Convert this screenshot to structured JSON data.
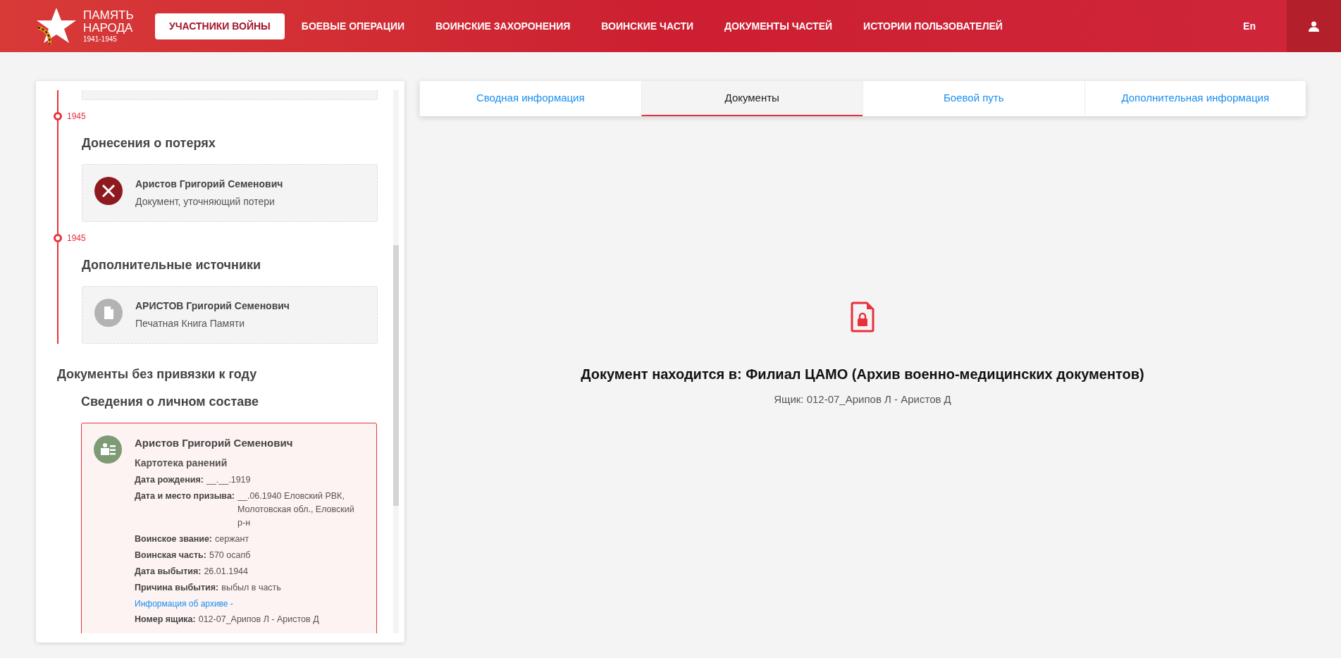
{
  "header": {
    "logo": {
      "line1": "ПАМЯТЬ",
      "line2": "НАРОДА",
      "years": "1941-1945"
    },
    "nav": [
      {
        "label": "УЧАСТНИКИ ВОЙНЫ",
        "selected": true
      },
      {
        "label": "БОЕВЫЕ ОПЕРАЦИИ",
        "selected": false
      },
      {
        "label": "ВОИНСКИЕ ЗАХОРОНЕНИЯ",
        "selected": false
      },
      {
        "label": "ВОИНСКИЕ ЧАСТИ",
        "selected": false
      },
      {
        "label": "ДОКУМЕНТЫ ЧАСТЕЙ",
        "selected": false
      },
      {
        "label": "ИСТОРИИ ПОЛЬЗОВАТЕЛЕЙ",
        "selected": false
      }
    ],
    "language": "En"
  },
  "timeline": [
    {
      "year": "1945",
      "heading": "Донесения о потерях",
      "documents": [
        {
          "kind": "loss",
          "name": "Аристов Григорий Семенович",
          "type": "Документ, уточняющий потери",
          "selected": false
        }
      ]
    },
    {
      "year": "1945",
      "heading": "Дополнительные источники",
      "documents": [
        {
          "kind": "book",
          "name": "АРИСТОВ Григорий Семенович",
          "type": "Печатная Книга Памяти",
          "selected": false
        }
      ]
    }
  ],
  "undated": {
    "heading": "Документы без привязки к году",
    "section_heading": "Сведения о личном составе",
    "documents": [
      {
        "kind": "card",
        "name": "Аристов Григорий Семенович",
        "type": "Картотека ранений",
        "selected": true,
        "fields": [
          {
            "kind": "field",
            "label": "Дата рождения:",
            "value": "__.__.1919"
          },
          {
            "kind": "field",
            "label": "Дата и место призыва:",
            "value": "__.06.1940 Еловский РВК, Молотовская обл., Еловский р-н"
          },
          {
            "kind": "field",
            "label": "Воинское звание:",
            "value": "сержант"
          },
          {
            "kind": "field",
            "label": "Воинская часть:",
            "value": "570 осапб"
          },
          {
            "kind": "field",
            "label": "Дата выбытия:",
            "value": "26.01.1944"
          },
          {
            "kind": "field",
            "label": "Причина выбытия:",
            "value": "выбыл в часть"
          },
          {
            "kind": "link",
            "label": "Информация об архиве -"
          },
          {
            "kind": "field",
            "label": "Номер ящика:",
            "value": "012-07_Арипов Л - Аристов Д"
          }
        ]
      }
    ]
  },
  "tabs": [
    {
      "label": "Сводная информация",
      "selected": false
    },
    {
      "label": "Документы",
      "selected": true
    },
    {
      "label": "Боевой путь",
      "selected": false
    },
    {
      "label": "Дополнительная информация",
      "selected": false
    }
  ],
  "notice": {
    "title": "Документ находится в: Филиал ЦАМО (Архив военно-медицинских документов)",
    "box": "Ящик: 012-07_Арипов Л - Аристов Д"
  }
}
